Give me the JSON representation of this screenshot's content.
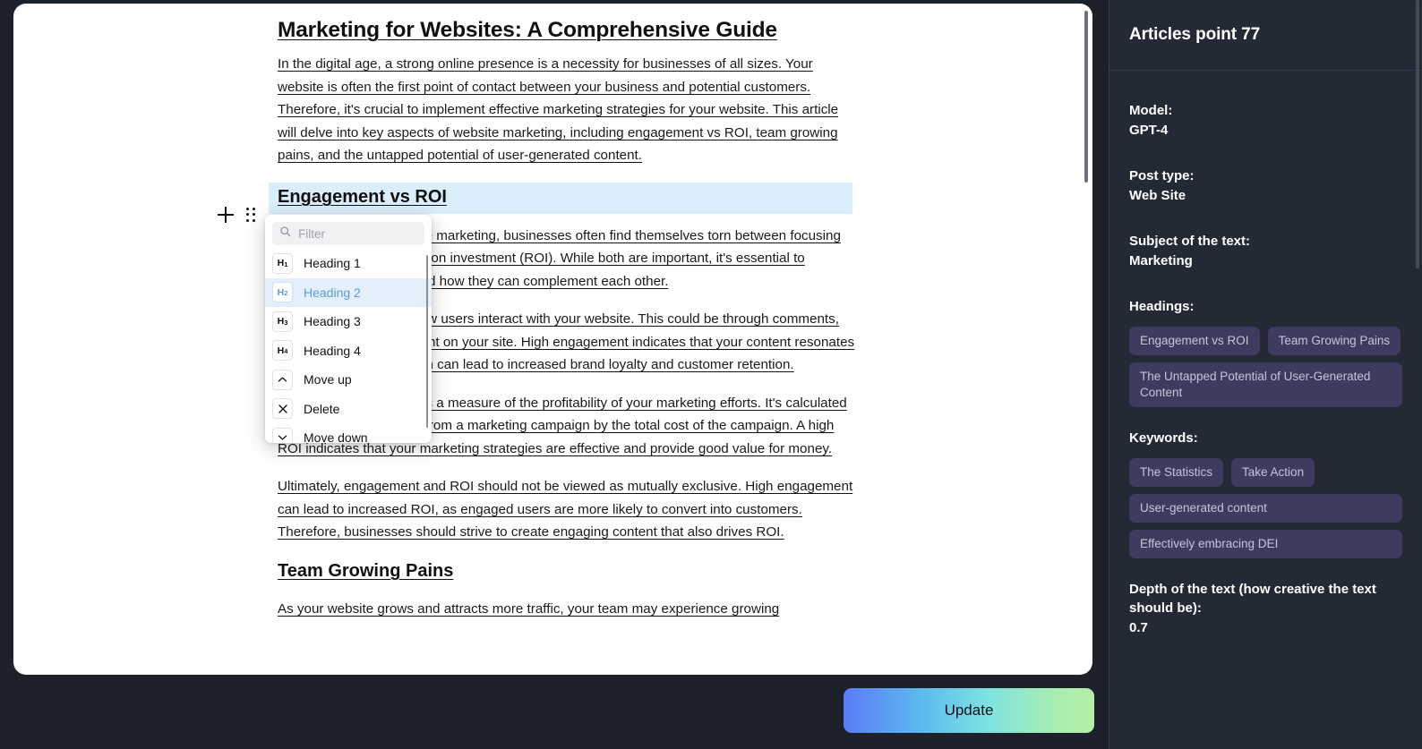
{
  "editor": {
    "block_controls": {
      "add_label": "+",
      "drag_label": "drag-handle"
    },
    "document": {
      "title": "Marketing for Websites: A Comprehensive Guide",
      "intro": "In the digital age, a strong online presence is a necessity for businesses of all sizes. Your website is often the first point of contact between your business and potential customers. Therefore, it's crucial to implement effective marketing strategies for your website. This article will delve into key aspects of website marketing, including engagement vs ROI, team growing pains, and the untapped potential of user-generated content.",
      "heading_engagement": "Engagement vs ROI",
      "para_engagement_1": "When it comes to website marketing, businesses often find themselves torn between focusing on engagement or return on investment (ROI). While both are important, it's essential to understand their roles and how they can complement each other.",
      "para_engagement_2": "Engagement refers to how users interact with your website. This could be through comments, shares, likes, or time spent on your site. High engagement indicates that your content resonates with your audience, which can lead to increased brand loyalty and customer retention.",
      "para_engagement_3": "On the other hand, ROI is a measure of the profitability of your marketing efforts. It's calculated by dividing the net profit from a marketing campaign by the total cost of the campaign. A high ROI indicates that your marketing strategies are effective and provide good value for money.",
      "para_engagement_4": "Ultimately, engagement and ROI should not be viewed as mutually exclusive. High engagement can lead to increased ROI, as engaged users are more likely to convert into customers. Therefore, businesses should strive to create engaging content that also drives ROI.",
      "heading_team": "Team Growing Pains",
      "para_team_1": "As your website grows and attracts more traffic, your team may experience growing"
    }
  },
  "dropdown": {
    "search_placeholder": "Filter",
    "search_value": "",
    "search_icon": "search-icon",
    "items": [
      {
        "icon": "H1",
        "icon_name": "heading-1-icon",
        "label": "Heading 1",
        "active": false
      },
      {
        "icon": "H2",
        "icon_name": "heading-2-icon",
        "label": "Heading 2",
        "active": true
      },
      {
        "icon": "H3",
        "icon_name": "heading-3-icon",
        "label": "Heading 3",
        "active": false
      },
      {
        "icon": "H4",
        "icon_name": "heading-4-icon",
        "label": "Heading 4",
        "active": false
      },
      {
        "icon": "⌃",
        "icon_name": "chevron-up-icon",
        "label": "Move up",
        "active": false
      },
      {
        "icon": "×",
        "icon_name": "close-icon",
        "label": "Delete",
        "active": false
      },
      {
        "icon": "⌄",
        "icon_name": "chevron-down-icon",
        "label": "Move down",
        "active": false
      }
    ]
  },
  "sidebar": {
    "title": "Articles point 77",
    "fields": [
      {
        "label": "Model:",
        "value": "GPT-4"
      },
      {
        "label": "Post type:",
        "value": "Web Site"
      },
      {
        "label": "Subject of the text:",
        "value": "Marketing"
      }
    ],
    "headings_label": "Headings:",
    "headings": [
      "Engagement vs ROI",
      "Team Growing Pains",
      "The Untapped Potential of User-Generated Content"
    ],
    "keywords_label": "Keywords:",
    "keywords": [
      "The Statistics",
      "Take Action",
      "User-generated content",
      "Effectively embracing DEI"
    ],
    "depth_label": "Depth of the text (how creative the text should be):",
    "depth_value": "0.7"
  },
  "actions": {
    "update_label": "Update"
  },
  "colors": {
    "page_background": "#1d212b",
    "sidebar_background": "#242936",
    "tag_background": "#3e3b60",
    "tag_text": "#c6c4d8",
    "selection_highlight": "#daeefc",
    "dropdown_active": "#e3effa",
    "dropdown_active_text": "#5b9bd5",
    "update_gradient_start": "#5b7cf5",
    "update_gradient_end": "#b4f0a6"
  }
}
